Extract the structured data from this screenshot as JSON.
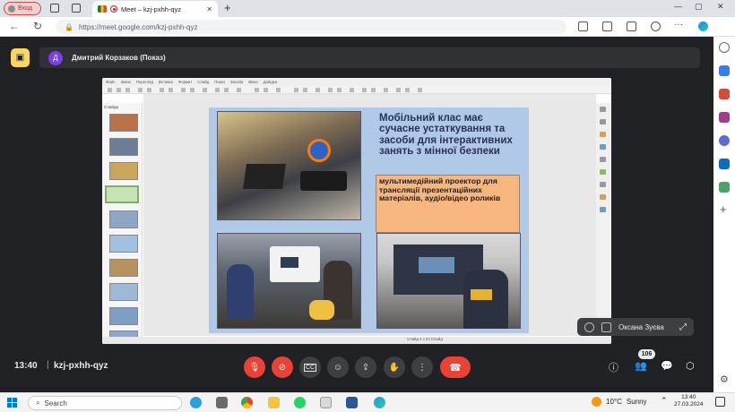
{
  "browser": {
    "profile_label": "Вход",
    "tab_title": "Meet – kzj-pxhh-qyz",
    "tab_close": "✕",
    "new_tab": "+",
    "url": "https://meet.google.com/kzj-pxhh-qyz",
    "window_controls": [
      "—",
      "▢",
      "✕"
    ]
  },
  "meet": {
    "presenter_initial": "Д",
    "presenter_title": "Дмитрий Корзаков (Показ)",
    "meeting_time": "13:40",
    "separator": "|",
    "meeting_code": "kzj-pxhh-qyz",
    "participant_name": "Оксана Зуєва",
    "participant_count": "106"
  },
  "slide": {
    "title": "Мобільний клас має сучасне устаткування та засоби для інтерактивних занять з мінної безпеки",
    "note": "мультимедійний проектор для трансляції презентаційних матеріалів, аудіо/відео роликів"
  },
  "app_window": {
    "thumbs_header": "Слайди",
    "status_text": "Слайд 4 з 23    Слайд",
    "menu_items": [
      "Файл",
      "Зміни",
      "Перегляд",
      "Вставка",
      "Формат",
      "Слайд",
      "Показ",
      "Засоби",
      "Вікно",
      "Довідка"
    ]
  },
  "taskbar": {
    "search_placeholder": "Search",
    "weather_temp": "10°C",
    "weather_text": "Sunny",
    "time": "13:40",
    "date": "27.03.2024"
  },
  "colors": {
    "accent_red": "#ea4335",
    "control_grey": "#3c4043",
    "present_yellow": "#fdd663",
    "slide_bg": "#b0c9e6",
    "note_bg": "#f7b67e"
  }
}
